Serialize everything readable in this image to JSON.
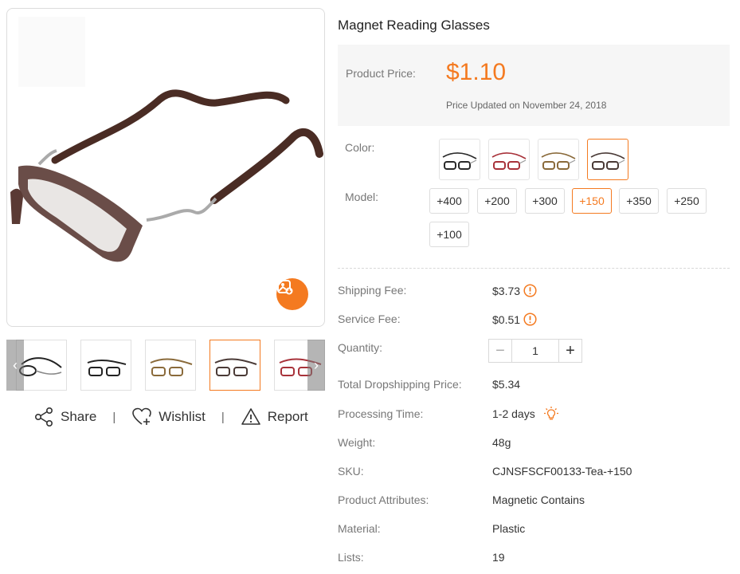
{
  "product": {
    "title": "Magnet Reading Glasses",
    "price_label": "Product Price:",
    "price": "$1.10",
    "price_updated": "Price Updated on November 24, 2018"
  },
  "options": {
    "color_label": "Color:",
    "colors": [
      {
        "name": "black",
        "frame_hex": "#2a2a2a"
      },
      {
        "name": "red",
        "frame_hex": "#a8323a"
      },
      {
        "name": "tea",
        "frame_hex": "#8a6a3a"
      },
      {
        "name": "brown",
        "frame_hex": "#4a3a36"
      }
    ],
    "selected_color_index": 3,
    "model_label": "Model:",
    "models": [
      "+400",
      "+200",
      "+300",
      "+150",
      "+350",
      "+250",
      "+100"
    ],
    "selected_model_index": 3
  },
  "fees": {
    "shipping_label": "Shipping Fee:",
    "shipping_value": "$3.73",
    "service_label": "Service Fee:",
    "service_value": "$0.51"
  },
  "quantity": {
    "label": "Quantity:",
    "value": "1"
  },
  "details": {
    "total_label": "Total Dropshipping Price:",
    "total_value": "$5.34",
    "processing_label": "Processing Time:",
    "processing_value": "1-2 days",
    "weight_label": "Weight:",
    "weight_value": "48g",
    "sku_label": "SKU:",
    "sku_value": "CJNSFSCF00133-Tea-+150",
    "attributes_label": "Product Attributes:",
    "attributes_value": "Magnetic Contains",
    "material_label": "Material:",
    "material_value": "Plastic",
    "lists_label": "Lists:",
    "lists_value": "19"
  },
  "gallery": {
    "thumbnails": [
      "black-glasses",
      "black-glasses-2",
      "tea-glasses",
      "brown-glasses",
      "red-glasses"
    ],
    "active_thumbnail_index": 3
  },
  "actions": {
    "share": "Share",
    "wishlist": "Wishlist",
    "report": "Report",
    "separator": "|"
  },
  "colors": {
    "accent": "#f47a20",
    "price_box_bg": "#f6f6f6"
  }
}
